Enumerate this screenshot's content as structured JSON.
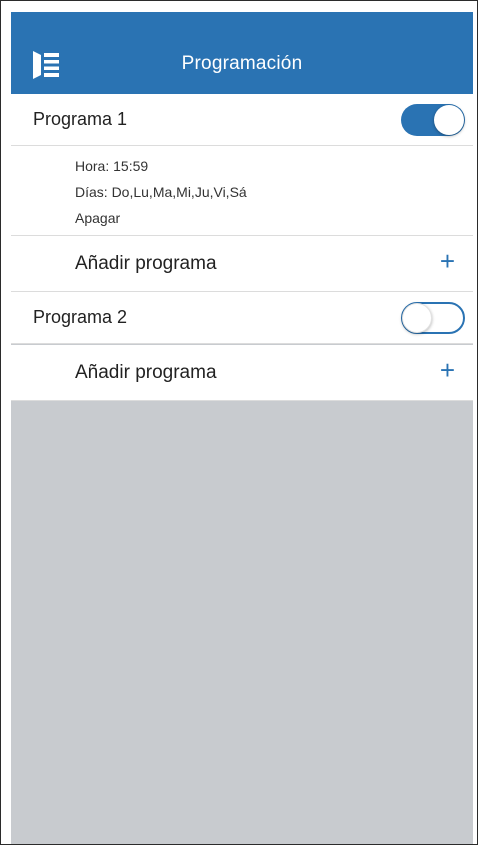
{
  "header": {
    "title": "Programación",
    "menu_icon": "menu-list-icon",
    "color": "#2a73b3"
  },
  "programs": [
    {
      "label": "Programa 1",
      "enabled": true,
      "details": {
        "hora": "Hora: 15:59",
        "dias": "Días: Do,Lu,Ma,Mi,Ju,Vi,Sá",
        "accion": "Apagar"
      },
      "add_label": "Añadir programa"
    },
    {
      "label": "Programa 2",
      "enabled": false,
      "add_label": "Añadir programa"
    }
  ],
  "add_icon": "+",
  "colors": {
    "accent": "#2a73b3",
    "empty_area": "#c8cbcf"
  }
}
